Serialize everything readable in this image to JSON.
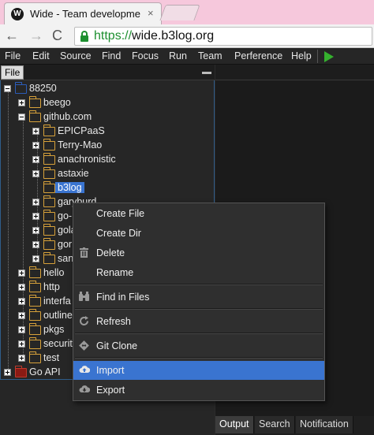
{
  "browser": {
    "tab_title": "Wide - Team developme",
    "tab_close": "×",
    "url_scheme": "https://",
    "url_host": "wide.b3log.org",
    "back": "←",
    "forward": "→",
    "reload": "C"
  },
  "menubar": {
    "items": [
      "File",
      "Edit",
      "Source",
      "Find",
      "Focus",
      "Run",
      "Team",
      "Perference",
      "Help"
    ]
  },
  "file_panel": {
    "tab_label": "File",
    "tree": [
      {
        "label": "88250"
      },
      {
        "label": "beego"
      },
      {
        "label": "github.com"
      },
      {
        "label": "EPICPaaS"
      },
      {
        "label": "Terry-Mao"
      },
      {
        "label": "anachronistic"
      },
      {
        "label": "astaxie"
      },
      {
        "label": "b3log"
      },
      {
        "label": "garyburd"
      },
      {
        "label": "go-"
      },
      {
        "label": "gola"
      },
      {
        "label": "gor"
      },
      {
        "label": "san"
      },
      {
        "label": "hello"
      },
      {
        "label": "http"
      },
      {
        "label": "interfa"
      },
      {
        "label": "outline"
      },
      {
        "label": "pkgs"
      },
      {
        "label": "securit"
      },
      {
        "label": "test"
      },
      {
        "label": "Go API"
      }
    ]
  },
  "context_menu": {
    "items": [
      {
        "label": "Create File",
        "icon": ""
      },
      {
        "label": "Create Dir",
        "icon": ""
      },
      {
        "label": "Delete",
        "icon": "trash-icon"
      },
      {
        "label": "Rename",
        "icon": ""
      },
      {
        "label": "Find in Files",
        "icon": "binoculars-icon"
      },
      {
        "label": "Refresh",
        "icon": "refresh-icon"
      },
      {
        "label": "Git Clone",
        "icon": "git-icon"
      },
      {
        "label": "Import",
        "icon": "cloud-upload-icon"
      },
      {
        "label": "Export",
        "icon": "cloud-download-icon"
      }
    ]
  },
  "bottom_tabs": [
    "Output",
    "Search",
    "Notification"
  ],
  "colors": {
    "selection": "#3a74d0",
    "run": "#35b12e",
    "url_secure": "#1d8f2f",
    "folder": "#d7a13a"
  }
}
